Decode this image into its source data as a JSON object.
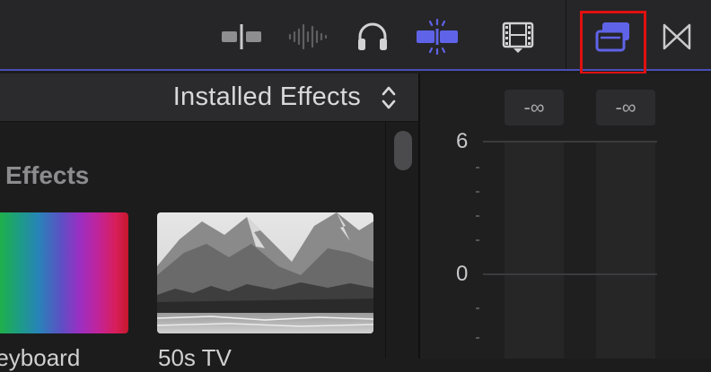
{
  "browser": {
    "title": "Installed Effects",
    "section_label": "Effects",
    "thumbnails": [
      {
        "label": "Keyboard"
      },
      {
        "label": "50s TV"
      }
    ]
  },
  "meters": {
    "peak_left": "-∞",
    "peak_right": "-∞",
    "scale": [
      "6",
      "0"
    ]
  },
  "colors": {
    "accent": "#5f63e8",
    "highlight_box": "#e01010",
    "toolbar_bg": "#262628"
  }
}
